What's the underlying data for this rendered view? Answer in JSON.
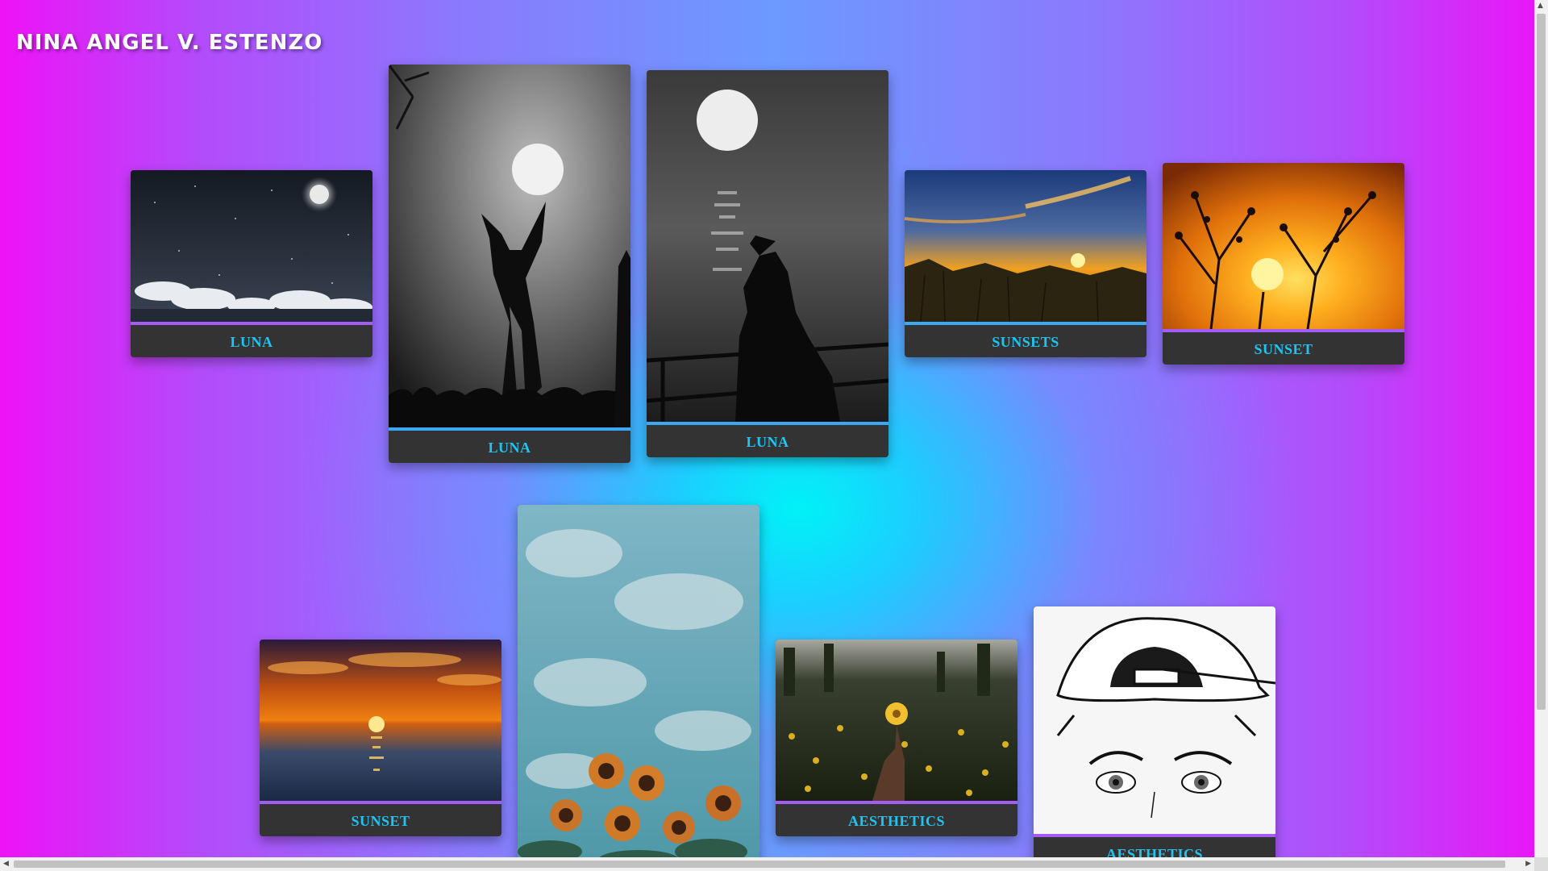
{
  "page": {
    "title": "NINA ANGEL V. ESTENZO"
  },
  "colors": {
    "background_edges": "#ee12f7",
    "background_mid": "#6c9afe",
    "background_center_glow": "#00f2f6",
    "card_background": "#333333",
    "label_color": "#1fc4f2",
    "bar_blue": "#3aa8f5",
    "bar_purple": "#a55cf5"
  },
  "cards": [
    {
      "label": "LUNA",
      "image": "night sky with moon and clouds"
    },
    {
      "label": "LUNA",
      "image": "silhouette of woman holding the moon"
    },
    {
      "label": "LUNA",
      "image": "woman at railing under full moon over sea"
    },
    {
      "label": "SUNSETS",
      "image": "golden sunset over wildflowers"
    },
    {
      "label": "SUNSET",
      "image": "tree branches silhouetted against orange sun"
    },
    {
      "label": "SUNSET",
      "image": "orange sunset over the ocean"
    },
    {
      "label": "",
      "image": "sunflowers under cloudy blue sky"
    },
    {
      "label": "AESTHETICS",
      "image": "hand holding yellow flower in field"
    },
    {
      "label": "AESTHETICS",
      "image": "line drawing of girl with cap"
    }
  ]
}
